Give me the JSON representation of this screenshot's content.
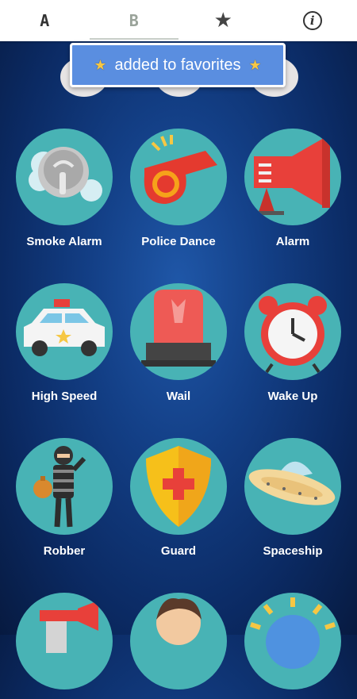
{
  "tabs": [
    {
      "label": "A",
      "icon": "letter-a-icon"
    },
    {
      "label": "B",
      "icon": "letter-b-icon"
    },
    {
      "label": "",
      "icon": "star-icon"
    },
    {
      "label": "",
      "icon": "info-icon"
    }
  ],
  "toast": {
    "text": "added to favorites",
    "icon": "star-icon",
    "star_color": "#f6c744"
  },
  "sounds": [
    {
      "label": "Smoke Alarm",
      "icon": "smoke-detector-icon"
    },
    {
      "label": "Police Dance",
      "icon": "whistle-icon"
    },
    {
      "label": "Alarm",
      "icon": "megaphone-icon"
    },
    {
      "label": "High Speed",
      "icon": "police-car-icon"
    },
    {
      "label": "Wail",
      "icon": "siren-light-icon"
    },
    {
      "label": "Wake Up",
      "icon": "alarm-clock-icon"
    },
    {
      "label": "Robber",
      "icon": "robber-icon"
    },
    {
      "label": "Guard",
      "icon": "shield-icon"
    },
    {
      "label": "Spaceship",
      "icon": "ufo-icon"
    },
    {
      "label": "",
      "icon": "air-horn-icon"
    },
    {
      "label": "",
      "icon": "person-icon"
    },
    {
      "label": "",
      "icon": "sun-icon"
    }
  ],
  "colors": {
    "circle": "#48b3b5",
    "toast": "#5a8ee0",
    "background": "#133f86"
  }
}
